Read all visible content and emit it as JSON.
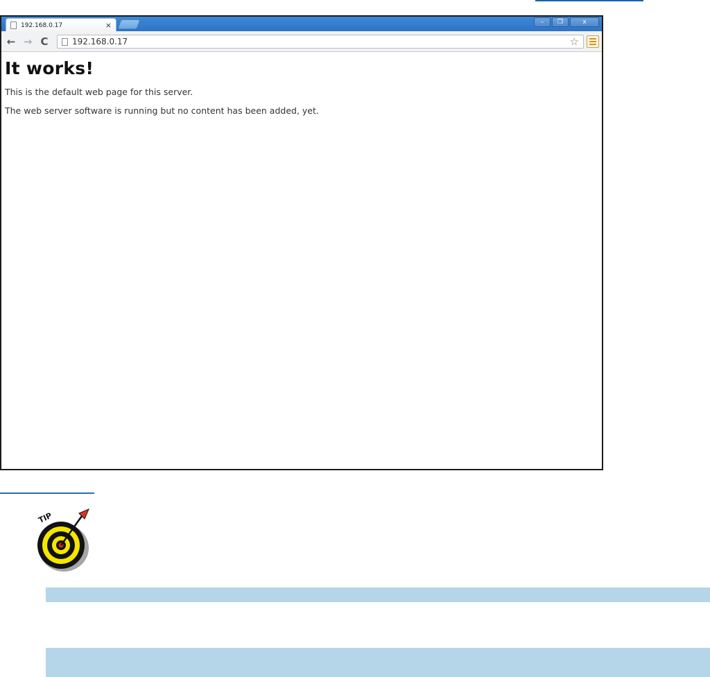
{
  "browser": {
    "tab": {
      "title": "192.168.0.17",
      "close_label": "×"
    },
    "window_controls": {
      "minimize": "–",
      "restore": "❐",
      "close": "x"
    },
    "nav": {
      "back": "←",
      "forward": "→",
      "reload": "C"
    },
    "address_bar": {
      "url": "192.168.0.17"
    },
    "page": {
      "heading": "It works!",
      "paragraphs": [
        "This is the default web page for this server.",
        "The web server software is running but no content has been added, yet."
      ]
    }
  },
  "tip_badge": {
    "label": "TIP"
  },
  "colors": {
    "title_bar": "#3c89d8",
    "highlight_bar": "#b5d6e8",
    "rule": "#2b6cb0"
  }
}
